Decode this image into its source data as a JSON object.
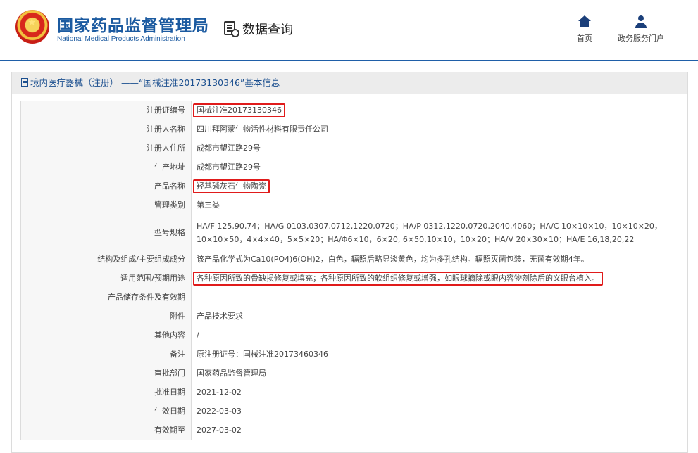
{
  "header": {
    "brand_cn": "国家药品监督管理局",
    "brand_en": "National Medical Products Administration",
    "query_title": "数据查询",
    "nav": [
      {
        "label": "首页",
        "icon": "home-icon"
      },
      {
        "label": "政务服务门户",
        "icon": "user-icon"
      }
    ],
    "colors": {
      "brand": "#1b5aa0",
      "nav_icon": "#1b3f7a",
      "highlight": "#e01b1b"
    }
  },
  "panel": {
    "title": "境内医疗器械（注册） ——“国械注准20173130346”基本信息",
    "rows": [
      {
        "label": "注册证编号",
        "value": "国械注准20173130346"
      },
      {
        "label": "注册人名称",
        "value": "四川拜阿蒙生物活性材料有限责任公司"
      },
      {
        "label": "注册人住所",
        "value": "成都市望江路29号"
      },
      {
        "label": "生产地址",
        "value": "成都市望江路29号"
      },
      {
        "label": "产品名称",
        "value": "羟基磷灰石生物陶瓷"
      },
      {
        "label": "管理类别",
        "value": "第三类"
      },
      {
        "label": "型号规格",
        "value": "HA/F 125,90,74；HA/G 0103,0307,0712,1220,0720；HA/P 0312,1220,0720,2040,4060；HA/C 10×10×10，10×10×20，10×10×50，4×4×40，5×5×20；HA/Φ6×10，6×20, 6×50,10×10，10×20；HA/V 20×30×10；HA/E 16,18,20,22"
      },
      {
        "label": "结构及组成/主要组成成分",
        "value": "该产品化学式为Ca10(PO4)6(OH)2，白色，辐照后略显淡黄色，均为多孔结构。辐照灭菌包装，无菌有效期4年。"
      },
      {
        "label": "适用范围/预期用途",
        "value": "各种原因所致的骨缺损修复或填充；各种原因所致的软组织修复或增强，如眼球摘除或眼内容物剜除后的义眼台植入。"
      },
      {
        "label": "产品储存条件及有效期",
        "value": ""
      },
      {
        "label": "附件",
        "value": "产品技术要求"
      },
      {
        "label": "其他内容",
        "value": "/"
      },
      {
        "label": "备注",
        "value": "原注册证号：国械注准20173460346"
      },
      {
        "label": "审批部门",
        "value": "国家药品监督管理局"
      },
      {
        "label": "批准日期",
        "value": "2021-12-02"
      },
      {
        "label": "生效日期",
        "value": "2022-03-03"
      },
      {
        "label": "有效期至",
        "value": "2027-03-02"
      }
    ]
  }
}
